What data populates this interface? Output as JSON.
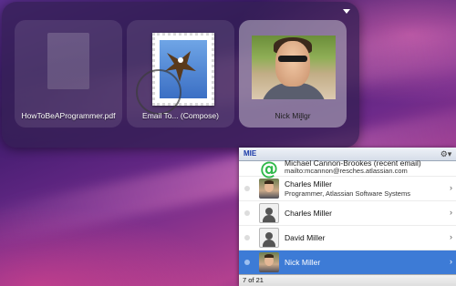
{
  "panes": [
    {
      "label": "HowToBeAProgrammer.pdf",
      "icon": "pdf-document-icon"
    },
    {
      "label": "Email To... (Compose)",
      "icon": "mail-stamp-icon"
    },
    {
      "label_prefix": "Nick Mi",
      "label_underlined": "l",
      "label_suffix": "lgr",
      "icon": "contact-photo"
    }
  ],
  "list": {
    "search_text": "MIE",
    "gear_icon": "⚙▾",
    "rows": [
      {
        "name": "Michael Cannon-Brookes (recent email)",
        "sub": "mailto:mcannon@resches.atlassian.com",
        "avatar": "email-at-icon"
      },
      {
        "name": "Charles Miller",
        "sub": "Programmer, Atlassian Software Systems",
        "avatar": "photo"
      },
      {
        "name": "Charles Miller",
        "avatar": "placeholder"
      },
      {
        "name": "David Miller",
        "avatar": "placeholder"
      },
      {
        "name": "Nick Miller",
        "avatar": "photo",
        "selected": true
      }
    ],
    "chevron": "›",
    "count_text": "7 of 21"
  },
  "colors": {
    "selection": "#3d7bd6",
    "search_text": "#1a3aa8",
    "email_icon": "#2fb84a"
  }
}
